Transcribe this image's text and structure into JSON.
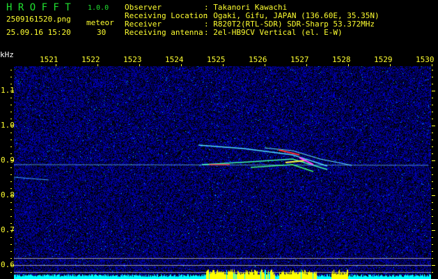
{
  "app": {
    "title": "H R O F F T",
    "version": "1.0.0"
  },
  "file": {
    "name": "2509161520.png",
    "datetime": "25.09.16 15:20",
    "meteor_label": "meteor",
    "meteor_count": "30"
  },
  "info": [
    {
      "label": "Observer",
      "value": ": Takanori Kawachi"
    },
    {
      "label": "Receiving Location",
      "value": ": Ogaki, Gifu, JAPAN (136.60E, 35.35N)"
    },
    {
      "label": "Receiver",
      "value": ": R820T2(RTL-SDR) SDR-Sharp 53.372MHz"
    },
    {
      "label": "Receiving antenna",
      "value": ": 2el-HB9CV Vertical (el. E-W)"
    }
  ],
  "axis": {
    "y_unit": "kHz",
    "x_ticks": [
      "1521",
      "1522",
      "1523",
      "1524",
      "1525",
      "1526",
      "1527",
      "1528",
      "1529",
      "1530"
    ],
    "y_ticks": [
      "1.1",
      "1.0",
      "0.9",
      "0.8",
      "0.7",
      "0.6"
    ]
  },
  "colors": {
    "text": "#ffff30",
    "title": "#20e030",
    "noise": "#1020c0",
    "baseline": "#00ffff",
    "peak": "#ffff00"
  }
}
